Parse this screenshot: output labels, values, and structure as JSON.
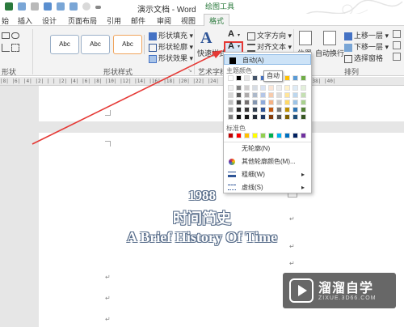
{
  "app": {
    "title": "演示文档 - Word",
    "context_tab": "绘图工具"
  },
  "colors": {
    "accent": "#2b7a3d",
    "highlight_red": "#e53935",
    "theme_blue": "#2f5597"
  },
  "tabs": [
    "始",
    "插入",
    "设计",
    "页面布局",
    "引用",
    "邮件",
    "审阅",
    "视图",
    "格式"
  ],
  "ribbon": {
    "left_group_label": "形状",
    "style_boxes": [
      "Abc",
      "Abc",
      "Abc"
    ],
    "shape_fill": "形状填充",
    "shape_outline": "形状轮廓",
    "shape_effect": "形状效果",
    "shape_style_label": "形状样式",
    "quick_style": "快速样式",
    "wordart_label": "艺术字样",
    "text_direction": "文字方向",
    "align_text": "对齐文本",
    "position": "位置",
    "wrap_text": "自动换行",
    "bring_forward": "上移一层",
    "send_backward": "下移一层",
    "selection_pane": "选择窗格",
    "arrange_label": "排列"
  },
  "ruler": "|8|  |6|  |4|  |2|  | |  |2|  |4|  |6|  |8|  |10| |12| |14| |16| |18| |20| |22| |24| |26| |28| |30| |32| |34| |36| |38| |40|",
  "document": {
    "line1": "1988",
    "line2": "时间简史",
    "line3": "A Brief History Of Time"
  },
  "dropdown": {
    "auto": "自动(A)",
    "theme_colors_label": "主题颜色",
    "standard_colors_label": "标准色",
    "no_outline": "无轮廓(N)",
    "more_colors": "其他轮廓颜色(M)...",
    "weight": "粗细(W)",
    "dashes": "虚线(S)",
    "theme_top": [
      "#ffffff",
      "#000000",
      "#e7e6e6",
      "#44546a",
      "#4472c4",
      "#ed7d31",
      "#a5a5a5",
      "#ffc000",
      "#5b9bd5",
      "#70ad47"
    ],
    "theme_shades": [
      [
        "#f2f2f2",
        "#7f7f7f",
        "#d0cece",
        "#d6dce4",
        "#d9e2f3",
        "#fbe5d5",
        "#ededed",
        "#fff2cc",
        "#deebf6",
        "#e2efd9"
      ],
      [
        "#d8d8d8",
        "#595959",
        "#aeabab",
        "#adb9ca",
        "#b4c6e7",
        "#f7cbac",
        "#dbdbdb",
        "#ffe599",
        "#bdd7ee",
        "#c5e0b3"
      ],
      [
        "#bfbfbf",
        "#3f3f3f",
        "#757070",
        "#8496b0",
        "#8eaadb",
        "#f4b183",
        "#c9c9c9",
        "#ffd965",
        "#9dc3e6",
        "#a8d08d"
      ],
      [
        "#a5a5a5",
        "#262626",
        "#3a3838",
        "#323f4f",
        "#2f5496",
        "#c55a11",
        "#7b7b7b",
        "#bf9000",
        "#2e75b5",
        "#538135"
      ],
      [
        "#7f7f7f",
        "#0c0c0c",
        "#171616",
        "#222a35",
        "#1f3864",
        "#833c0b",
        "#525252",
        "#7f6000",
        "#1e4e79",
        "#375623"
      ]
    ],
    "standard": [
      "#c00000",
      "#ff0000",
      "#ffc000",
      "#ffff00",
      "#92d050",
      "#00b050",
      "#00b0f0",
      "#0070c0",
      "#002060",
      "#7030a0"
    ]
  },
  "tooltip": "自动",
  "watermark": {
    "title": "溜溜自学",
    "subtitle": "ZIXUE.3D66.COM"
  }
}
